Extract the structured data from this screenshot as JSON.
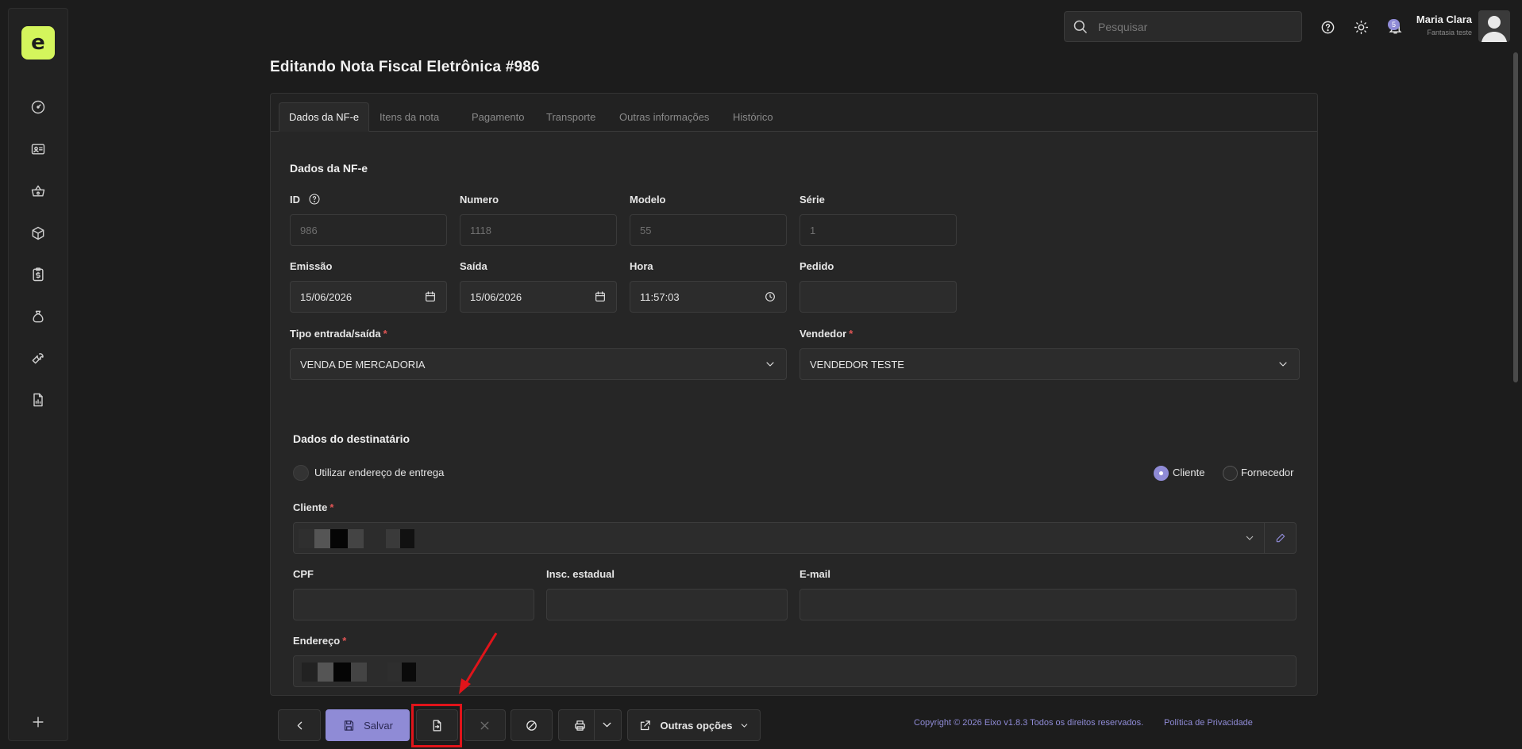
{
  "app": {
    "logo_text": "e",
    "accent": "#8f8bd6",
    "brand": "#d4f55c"
  },
  "sidebar": {
    "items": [
      {
        "name": "dashboard",
        "icon": "gauge-icon"
      },
      {
        "name": "contacts",
        "icon": "id-card-icon"
      },
      {
        "name": "sales",
        "icon": "basket-icon"
      },
      {
        "name": "products",
        "icon": "box-icon"
      },
      {
        "name": "finance",
        "icon": "clipboard-dollar-icon"
      },
      {
        "name": "money",
        "icon": "money-bag-icon"
      },
      {
        "name": "tools",
        "icon": "wrench-icon"
      },
      {
        "name": "reports",
        "icon": "report-icon"
      }
    ],
    "add_icon": "plus-icon"
  },
  "topbar": {
    "search_placeholder": "Pesquisar",
    "notifications_count": "5",
    "user_name": "Maria Clara",
    "user_company": "Fantasia teste"
  },
  "page": {
    "title": "Editando Nota Fiscal Eletrônica #986"
  },
  "tabs": [
    {
      "label": "Dados da NF-e",
      "active": true
    },
    {
      "label": "Itens da nota",
      "active": false
    },
    {
      "label": "Pagamento",
      "active": false
    },
    {
      "label": "Transporte",
      "active": false
    },
    {
      "label": "Outras informações",
      "active": false
    },
    {
      "label": "Histórico",
      "active": false
    }
  ],
  "nfe": {
    "section_title": "Dados da NF-e",
    "id": {
      "label": "ID",
      "value": "986"
    },
    "numero": {
      "label": "Numero",
      "value": "1118"
    },
    "modelo": {
      "label": "Modelo",
      "value": "55"
    },
    "serie": {
      "label": "Série",
      "value": "1"
    },
    "emissao": {
      "label": "Emissão",
      "value": "15/06/2026"
    },
    "saida": {
      "label": "Saída",
      "value": "15/06/2026"
    },
    "hora": {
      "label": "Hora",
      "value": "11:57:03"
    },
    "pedido": {
      "label": "Pedido",
      "value": ""
    },
    "tipo": {
      "label": "Tipo entrada/saída",
      "required": "*",
      "value": "VENDA DE MERCADORIA"
    },
    "vendedor": {
      "label": "Vendedor",
      "required": "*",
      "value": "VENDEDOR TESTE"
    }
  },
  "destinatario": {
    "section_title": "Dados do destinatário",
    "entrega_toggle_label": "Utilizar endereço de entrega",
    "radio_cliente": "Cliente",
    "radio_fornecedor": "Fornecedor",
    "cliente": {
      "label": "Cliente",
      "required": "*"
    },
    "cpf": {
      "label": "CPF",
      "value": ""
    },
    "inscricao": {
      "label": "Insc. estadual",
      "value": ""
    },
    "email": {
      "label": "E-mail",
      "value": ""
    },
    "endereco": {
      "label": "Endereço",
      "required": "*"
    }
  },
  "toolbar": {
    "save_label": "Salvar",
    "more_options_label": "Outras opções"
  },
  "footer": {
    "copyright": "Copyright © 2026 Eixo v1.8.3 Todos os direitos reservados.",
    "privacy": "Política de Privacidade"
  }
}
